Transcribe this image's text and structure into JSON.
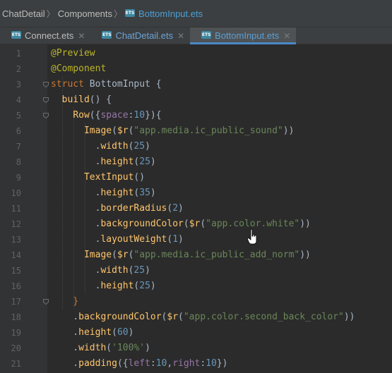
{
  "breadcrumb": {
    "items": [
      "ChatDetail",
      "Compoments"
    ],
    "current": "BottomInput.ets",
    "file_icon": "ets-file-icon"
  },
  "tabs": [
    {
      "label": "Connect.ets",
      "icon": "ets-file-icon",
      "active": false,
      "color": "#bbbbbb"
    },
    {
      "label": "ChatDetail.ets",
      "icon": "ets-file-icon",
      "active": false,
      "color": "#6ba3d6"
    },
    {
      "label": "BottomInput.ets",
      "icon": "ets-file-icon",
      "active": true,
      "color": "#5a9fd6"
    }
  ],
  "editor": {
    "colors": {
      "annotation": "#bbb529",
      "keyword": "#cc7832",
      "class": "#a9b7c6",
      "function": "#ffc66d",
      "string": "#6a8759",
      "number": "#6897bb",
      "property": "#9876aa",
      "default": "#a9b7c6"
    },
    "lines": [
      {
        "n": "1",
        "tokens": [
          [
            "annotation",
            "@Preview"
          ]
        ]
      },
      {
        "n": "2",
        "tokens": [
          [
            "annotation",
            "@Component"
          ]
        ]
      },
      {
        "n": "3",
        "tokens": [
          [
            "keyword",
            "struct "
          ],
          [
            "class",
            "BottomInput "
          ],
          [
            "default",
            "{"
          ]
        ]
      },
      {
        "n": "4",
        "tokens": [
          [
            "default",
            "  "
          ],
          [
            "function",
            "build"
          ],
          [
            "default",
            "() {"
          ]
        ]
      },
      {
        "n": "5",
        "tokens": [
          [
            "default",
            "    "
          ],
          [
            "function",
            "Row"
          ],
          [
            "default",
            "({"
          ],
          [
            "property",
            "space"
          ],
          [
            "default",
            ":"
          ],
          [
            "number",
            "10"
          ],
          [
            "default",
            "}){"
          ]
        ]
      },
      {
        "n": "6",
        "tokens": [
          [
            "default",
            "      "
          ],
          [
            "function",
            "Image"
          ],
          [
            "default",
            "("
          ],
          [
            "function",
            "$r"
          ],
          [
            "default",
            "("
          ],
          [
            "string",
            "\"app.media.ic_public_sound\""
          ],
          [
            "default",
            "))"
          ]
        ]
      },
      {
        "n": "7",
        "tokens": [
          [
            "default",
            "        ."
          ],
          [
            "function",
            "width"
          ],
          [
            "default",
            "("
          ],
          [
            "number",
            "25"
          ],
          [
            "default",
            ")"
          ]
        ]
      },
      {
        "n": "8",
        "tokens": [
          [
            "default",
            "        ."
          ],
          [
            "function",
            "height"
          ],
          [
            "default",
            "("
          ],
          [
            "number",
            "25"
          ],
          [
            "default",
            ")"
          ]
        ]
      },
      {
        "n": "9",
        "tokens": [
          [
            "default",
            "      "
          ],
          [
            "function",
            "TextInput"
          ],
          [
            "default",
            "()"
          ]
        ]
      },
      {
        "n": "10",
        "tokens": [
          [
            "default",
            "        ."
          ],
          [
            "function",
            "height"
          ],
          [
            "default",
            "("
          ],
          [
            "number",
            "35"
          ],
          [
            "default",
            ")"
          ]
        ]
      },
      {
        "n": "11",
        "tokens": [
          [
            "default",
            "        ."
          ],
          [
            "function",
            "borderRadius"
          ],
          [
            "default",
            "("
          ],
          [
            "number",
            "2"
          ],
          [
            "default",
            ")"
          ]
        ]
      },
      {
        "n": "12",
        "tokens": [
          [
            "default",
            "        ."
          ],
          [
            "function",
            "backgroundColor"
          ],
          [
            "default",
            "("
          ],
          [
            "function",
            "$r"
          ],
          [
            "default",
            "("
          ],
          [
            "string",
            "\"app.color.white\""
          ],
          [
            "default",
            "))"
          ]
        ]
      },
      {
        "n": "13",
        "tokens": [
          [
            "default",
            "        ."
          ],
          [
            "function",
            "layoutWeight"
          ],
          [
            "default",
            "("
          ],
          [
            "number",
            "1"
          ],
          [
            "default",
            ")"
          ]
        ]
      },
      {
        "n": "14",
        "tokens": [
          [
            "default",
            "      "
          ],
          [
            "function",
            "Image"
          ],
          [
            "default",
            "("
          ],
          [
            "function",
            "$r"
          ],
          [
            "default",
            "("
          ],
          [
            "string",
            "\"app.media.ic_public_add_norm\""
          ],
          [
            "default",
            "))"
          ]
        ]
      },
      {
        "n": "15",
        "tokens": [
          [
            "default",
            "        ."
          ],
          [
            "function",
            "width"
          ],
          [
            "default",
            "("
          ],
          [
            "number",
            "25"
          ],
          [
            "default",
            ")"
          ]
        ]
      },
      {
        "n": "16",
        "tokens": [
          [
            "default",
            "        ."
          ],
          [
            "function",
            "height"
          ],
          [
            "default",
            "("
          ],
          [
            "number",
            "25"
          ],
          [
            "default",
            ")"
          ]
        ]
      },
      {
        "n": "17",
        "tokens": [
          [
            "default",
            "    "
          ],
          [
            "keyword",
            "}"
          ]
        ]
      },
      {
        "n": "18",
        "tokens": [
          [
            "default",
            "    ."
          ],
          [
            "function",
            "backgroundColor"
          ],
          [
            "default",
            "("
          ],
          [
            "function",
            "$r"
          ],
          [
            "default",
            "("
          ],
          [
            "string",
            "\"app.color.second_back_color\""
          ],
          [
            "default",
            "))"
          ]
        ]
      },
      {
        "n": "19",
        "tokens": [
          [
            "default",
            "    ."
          ],
          [
            "function",
            "height"
          ],
          [
            "default",
            "("
          ],
          [
            "number",
            "60"
          ],
          [
            "default",
            ")"
          ]
        ]
      },
      {
        "n": "20",
        "tokens": [
          [
            "default",
            "    ."
          ],
          [
            "function",
            "width"
          ],
          [
            "default",
            "("
          ],
          [
            "string",
            "'100%'"
          ],
          [
            "default",
            ")"
          ]
        ]
      },
      {
        "n": "21",
        "tokens": [
          [
            "default",
            "    ."
          ],
          [
            "function",
            "padding"
          ],
          [
            "default",
            "({"
          ],
          [
            "property",
            "left"
          ],
          [
            "default",
            ":"
          ],
          [
            "number",
            "10"
          ],
          [
            "default",
            ","
          ],
          [
            "property",
            "right"
          ],
          [
            "default",
            ":"
          ],
          [
            "number",
            "10"
          ],
          [
            "default",
            "})"
          ]
        ]
      }
    ]
  }
}
